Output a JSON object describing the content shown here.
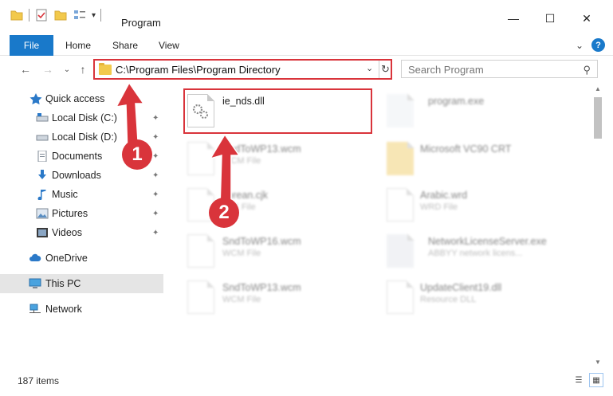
{
  "window": {
    "title": "Program",
    "minimize": "—",
    "maximize": "☐",
    "close": "✕"
  },
  "ribbon": {
    "tabs": [
      "File",
      "Home",
      "Share",
      "View"
    ],
    "expand": "⌄",
    "help": "?"
  },
  "address": {
    "back": "←",
    "forward": "→",
    "recent": "⌄",
    "up": "↑",
    "path": "C:\\Program Files\\Program Directory",
    "dropdown": "⌄",
    "refresh": "↻"
  },
  "search": {
    "placeholder": "Search Program",
    "icon": "⚲"
  },
  "navpane": {
    "items": [
      {
        "label": "Quick access",
        "icon": "star-icon",
        "pinned": false
      },
      {
        "label": "Local Disk (C:)",
        "icon": "drive-icon",
        "pinned": true
      },
      {
        "label": "Local Disk (D:)",
        "icon": "drive-icon",
        "pinned": true
      },
      {
        "label": "Documents",
        "icon": "documents-icon",
        "pinned": true
      },
      {
        "label": "Downloads",
        "icon": "downloads-icon",
        "pinned": true
      },
      {
        "label": "Music",
        "icon": "music-icon",
        "pinned": true
      },
      {
        "label": "Pictures",
        "icon": "pictures-icon",
        "pinned": true
      },
      {
        "label": "Videos",
        "icon": "videos-icon",
        "pinned": true
      },
      {
        "label": "OneDrive",
        "icon": "cloud-icon",
        "pinned": false
      },
      {
        "label": "This PC",
        "icon": "computer-icon",
        "pinned": false,
        "selected": true
      },
      {
        "label": "Network",
        "icon": "network-icon",
        "pinned": false
      }
    ],
    "pin_glyph": "📌"
  },
  "files": [
    {
      "name": "ie_nds.dll",
      "type": "",
      "highlighted": true
    },
    {
      "name": "program.exe",
      "type": ""
    },
    {
      "name": "SndToWP13.wcm",
      "type": "WCM File"
    },
    {
      "name": "Microsoft VC90 CRT",
      "type": ""
    },
    {
      "name": "korean.cjk",
      "type": "CJK File"
    },
    {
      "name": "Arabic.wrd",
      "type": "WRD File"
    },
    {
      "name": "SndToWP16.wcm",
      "type": "WCM File"
    },
    {
      "name": "NetworkLicenseServer.exe",
      "type": "ABBYY network licens..."
    },
    {
      "name": "SndToWP13.wcm",
      "type": "WCM File"
    },
    {
      "name": "UpdateClient19.dll",
      "type": "Resource DLL"
    }
  ],
  "status": {
    "items_count": "187 items"
  },
  "callouts": {
    "step1": "1",
    "step2": "2"
  },
  "colors": {
    "accent": "#1979ca",
    "callout": "#d9343b"
  }
}
